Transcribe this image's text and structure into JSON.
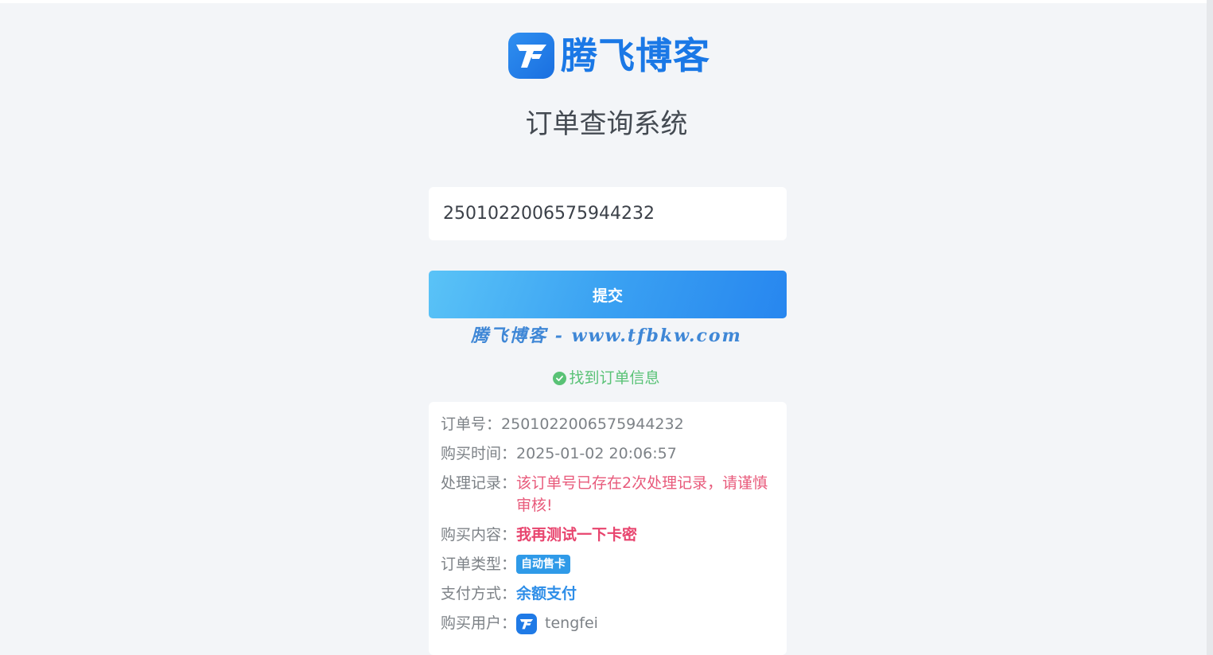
{
  "brand": {
    "name": "腾飞博客",
    "logo_icon": "tf-logo-icon",
    "color": "#1a78e6"
  },
  "page": {
    "title": "订单查询系统"
  },
  "search": {
    "value": "2501022006575944232"
  },
  "submit_label": "提交",
  "watermark": "腾飞博客 - www.tfbkw.com",
  "status": {
    "text": "找到订单信息",
    "icon": "check-circle-icon",
    "color": "#59c276"
  },
  "order": {
    "number_label": "订单号：",
    "number": "2501022006575944232",
    "time_label": "购买时间：",
    "time": "2025-01-02 20:06:57",
    "record_label": "处理记录：",
    "record": "该订单号已存在2次处理记录，请谨慎审核!",
    "content_label": "购买内容：",
    "content": "我再测试一下卡密",
    "type_label": "订单类型：",
    "type": "自动售卡",
    "pay_label": "支付方式：",
    "pay": "余额支付",
    "user_label": "购买用户：",
    "user": "tengfei"
  }
}
